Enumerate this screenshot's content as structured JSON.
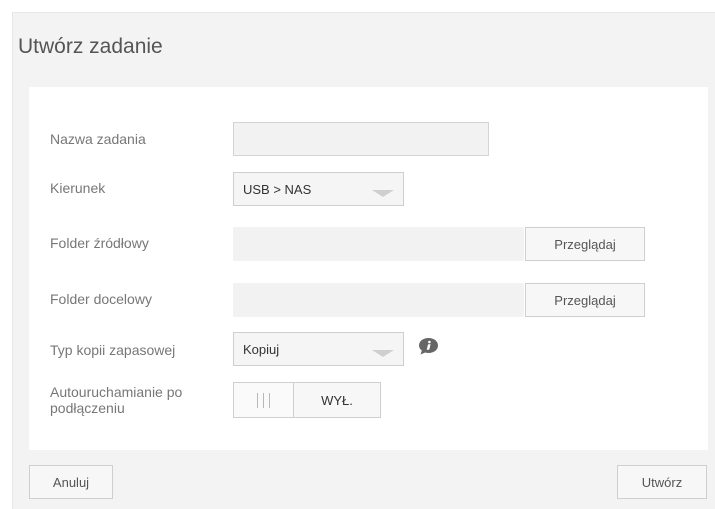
{
  "dialog": {
    "title": "Utwórz zadanie"
  },
  "form": {
    "job_name": {
      "label": "Nazwa zadania",
      "value": "",
      "placeholder": ""
    },
    "direction": {
      "label": "Kierunek",
      "selected": "USB > NAS"
    },
    "source_folder": {
      "label": "Folder źródłowy",
      "value": "",
      "browse_label": "Przeglądaj"
    },
    "destination_folder": {
      "label": "Folder docelowy",
      "value": "",
      "browse_label": "Przeglądaj"
    },
    "backup_type": {
      "label": "Typ kopii zapasowej",
      "selected": "Kopiuj",
      "info_icon": "info-icon"
    },
    "auto_start": {
      "label": "Autouruchamianie po podłączeniu",
      "state": "WYŁ."
    }
  },
  "footer": {
    "cancel_label": "Anuluj",
    "create_label": "Utwórz"
  },
  "colors": {
    "dialog_background": "#f3f3f3",
    "panel_background": "#ffffff",
    "field_background": "#f2f2f2",
    "label_text": "#777777",
    "info_icon": "#666666"
  }
}
